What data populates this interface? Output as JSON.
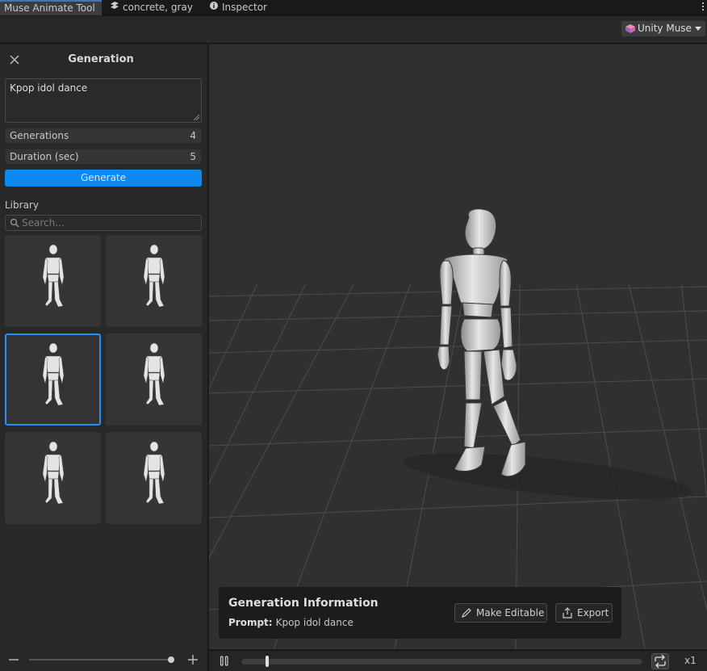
{
  "tabs": [
    {
      "label": "Muse Animate Tool",
      "active": true
    },
    {
      "label": "concrete, gray",
      "icon": "material-icon"
    },
    {
      "label": "Inspector",
      "icon": "info-icon"
    }
  ],
  "toolbar": {
    "dropdown_label": "Unity Muse"
  },
  "panel": {
    "title": "Generation",
    "prompt": "Kpop idol dance",
    "generations_label": "Generations",
    "generations_value": "4",
    "duration_label": "Duration (sec)",
    "duration_value": "5",
    "generate_label": "Generate",
    "library_label": "Library",
    "search_placeholder": "Search...",
    "thumbnails_count": 6,
    "selected_thumbnail": 2,
    "zoom_level": 0.98
  },
  "info_card": {
    "title": "Generation Information",
    "prompt_label": "Prompt:",
    "prompt_value": "Kpop idol dance",
    "make_editable_label": "Make Editable",
    "export_label": "Export"
  },
  "timeline": {
    "playhead_fraction": 0.06,
    "speed_label": "x1",
    "loop_enabled": true
  },
  "colors": {
    "accent": "#0e89f3",
    "selection": "#2a8ef4",
    "viewport_bg": "#2f3030"
  }
}
